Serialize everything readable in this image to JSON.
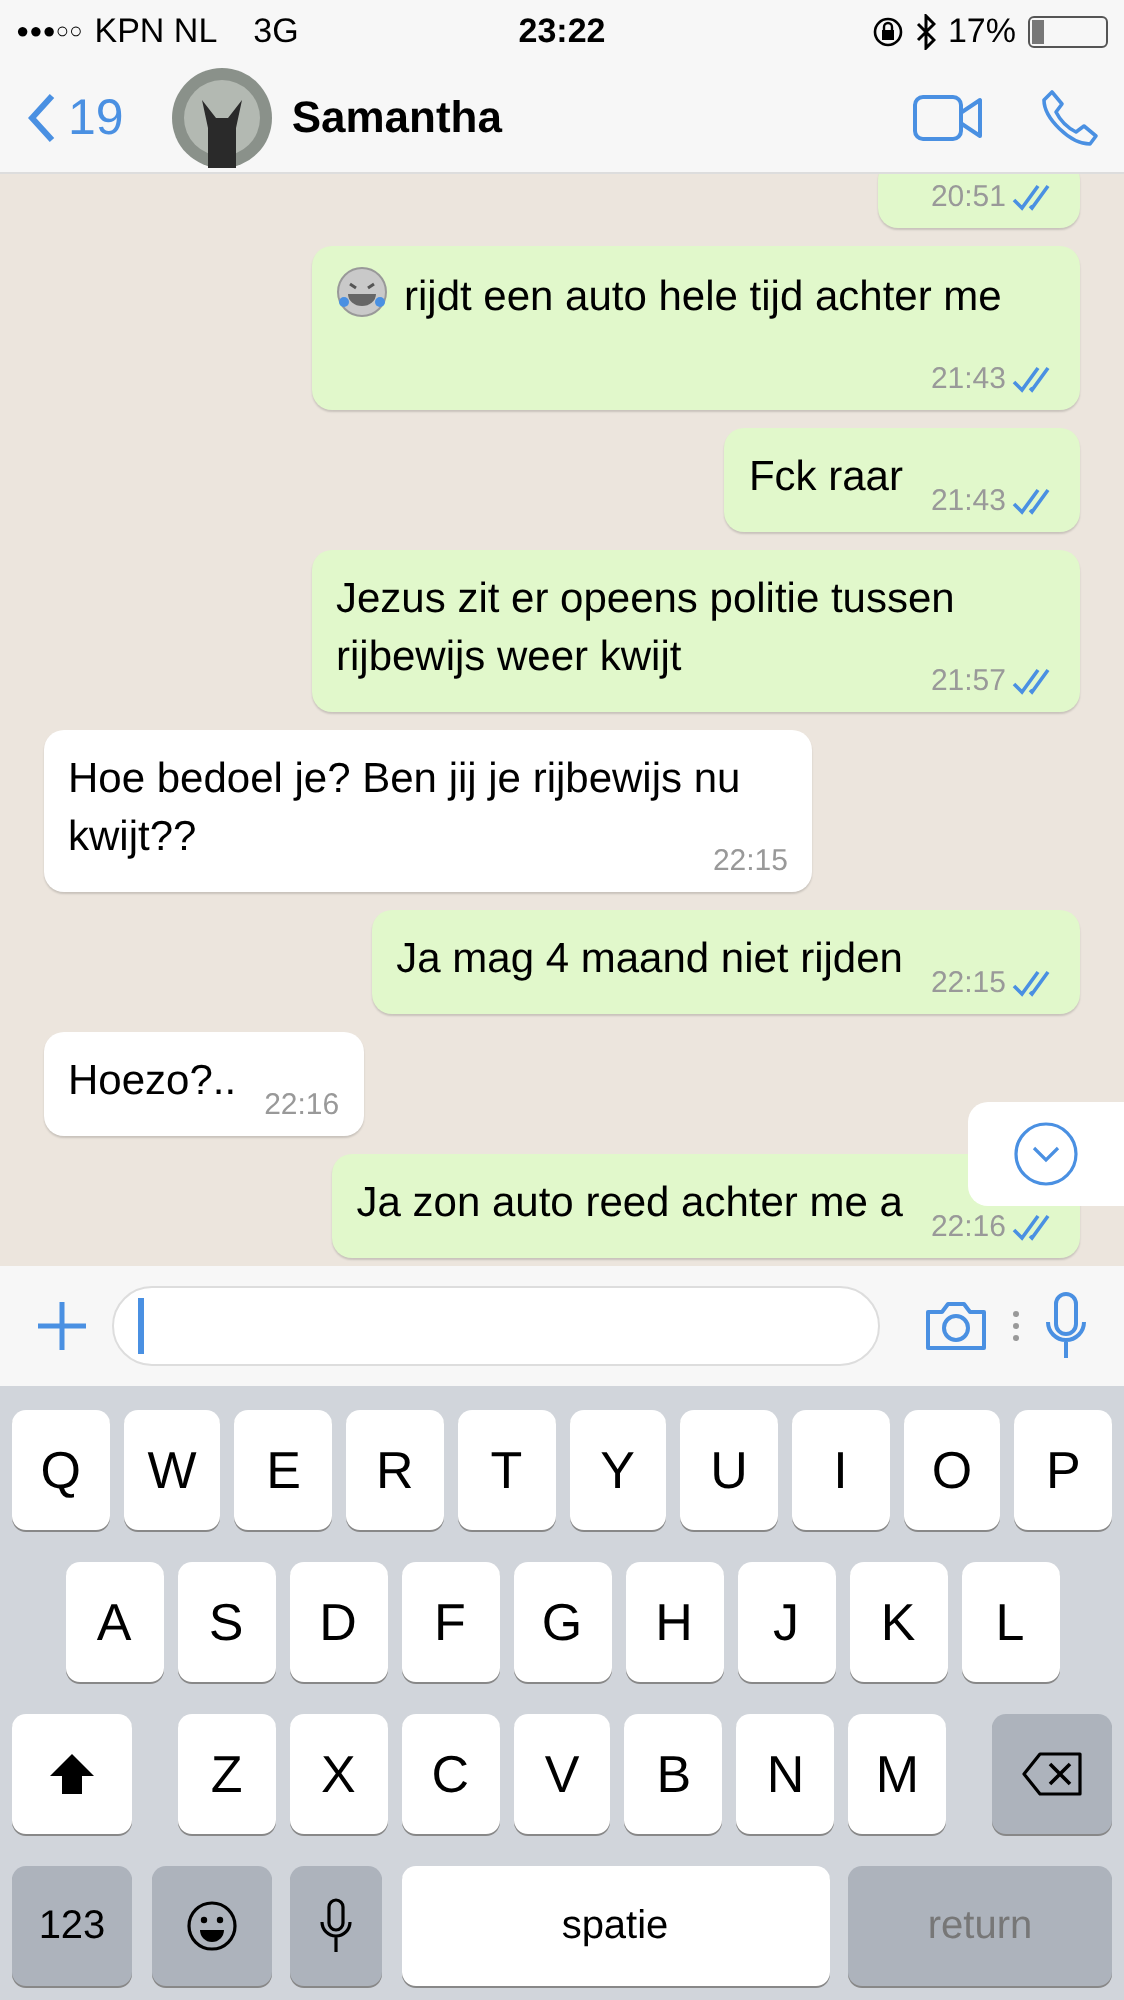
{
  "status_bar": {
    "signal_bars": "●●●○○",
    "carrier": "KPN NL",
    "network": "3G",
    "time": "23:22",
    "battery": "17%"
  },
  "header": {
    "back_count": "19",
    "contact_name": "Samantha"
  },
  "messages": [
    {
      "kind": "outgoing",
      "time": "20:51",
      "read": true,
      "emoji": false
    },
    {
      "kind": "outgoing",
      "text": "rijdt een auto hele tijd achter me",
      "time": "21:43",
      "read": true,
      "emoji": true
    },
    {
      "kind": "outgoing",
      "text": "Fck raar",
      "time": "21:43",
      "read": true,
      "emoji": false
    },
    {
      "kind": "outgoing",
      "text": "Jezus zit er opeens politie tussen rijbewijs weer kwijt",
      "time": "21:57",
      "read": true,
      "emoji": false
    },
    {
      "kind": "incoming",
      "text": "Hoe bedoel je? Ben jij je rijbewijs nu kwijt??",
      "time": "22:15",
      "emoji": false
    },
    {
      "kind": "outgoing",
      "text": "Ja mag 4 maand niet rijden",
      "time": "22:15",
      "read": true,
      "emoji": false
    },
    {
      "kind": "incoming",
      "text": "Hoezo?..",
      "time": "22:16",
      "emoji": false
    },
    {
      "kind": "outgoing",
      "text": "Ja zon auto reed achter me a",
      "time": "22:16",
      "read": true,
      "emoji": false
    }
  ],
  "keyboard": {
    "row_1": [
      {
        "kind": "letter",
        "label": "Q"
      },
      {
        "kind": "letter",
        "label": "W"
      },
      {
        "kind": "letter",
        "label": "E"
      },
      {
        "kind": "letter",
        "label": "R"
      },
      {
        "kind": "letter",
        "label": "T"
      },
      {
        "kind": "letter",
        "label": "Y"
      },
      {
        "kind": "letter",
        "label": "U"
      },
      {
        "kind": "letter",
        "label": "I"
      },
      {
        "kind": "letter",
        "label": "O"
      },
      {
        "kind": "letter",
        "label": "P"
      }
    ],
    "row_2": [
      {
        "kind": "letter",
        "label": "A"
      },
      {
        "kind": "letter",
        "label": "S"
      },
      {
        "kind": "letter",
        "label": "D"
      },
      {
        "kind": "letter",
        "label": "F"
      },
      {
        "kind": "letter",
        "label": "G"
      },
      {
        "kind": "letter",
        "label": "H"
      },
      {
        "kind": "letter",
        "label": "J"
      },
      {
        "kind": "letter",
        "label": "K"
      },
      {
        "kind": "letter",
        "label": "L"
      }
    ],
    "row_3": [
      {
        "kind": "shift"
      },
      {
        "kind": "letter",
        "label": "Z"
      },
      {
        "kind": "letter",
        "label": "X"
      },
      {
        "kind": "letter",
        "label": "C"
      },
      {
        "kind": "letter",
        "label": "V"
      },
      {
        "kind": "letter",
        "label": "B"
      },
      {
        "kind": "letter",
        "label": "N"
      },
      {
        "kind": "letter",
        "label": "M"
      },
      {
        "kind": "backspace"
      }
    ],
    "bottom_row": [
      {
        "kind": "numbers",
        "label": "123"
      },
      {
        "kind": "emoji"
      },
      {
        "kind": "mic"
      },
      {
        "kind": "space",
        "label": "spatie"
      },
      {
        "kind": "return",
        "label": "return"
      }
    ]
  }
}
